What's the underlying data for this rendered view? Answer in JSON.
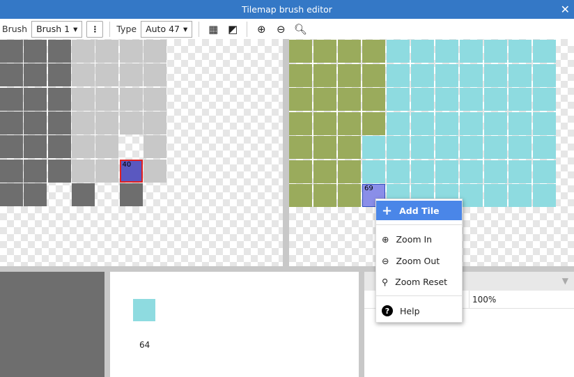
{
  "window": {
    "title": "Tilemap brush editor",
    "close_icon": "close-icon"
  },
  "toolbar": {
    "brush_label": "Brush",
    "brush_value": "Brush 1",
    "type_label": "Type",
    "type_value": "Auto 47",
    "more_icon": "vertical-dots-icon",
    "grid_icon": "grid-icon",
    "mode_icon": "half-square-icon",
    "zoom_in_icon": "zoom-in-icon",
    "zoom_out_icon": "zoom-out-icon",
    "zoom_reset_icon": "search-icon"
  },
  "left_canvas": {
    "selected_tile_label": "40"
  },
  "right_canvas": {
    "hovered_tile_label": "69"
  },
  "context_menu": {
    "items": [
      {
        "label": "Add Tile",
        "icon": "plus-icon"
      },
      {
        "label": "Zoom In",
        "icon": "zoom-in-icon"
      },
      {
        "label": "Zoom Out",
        "icon": "zoom-out-icon"
      },
      {
        "label": "Zoom Reset",
        "icon": "search-icon"
      },
      {
        "label": "Help",
        "icon": "help-icon"
      }
    ]
  },
  "preview": {
    "tile_id": "64",
    "swatch_color": "#8edbe0"
  },
  "properties": {
    "zoom_value": "100%"
  },
  "colors": {
    "accent": "#3478c6",
    "menu_highlight": "#4a86e8",
    "grass": "#9aab5c",
    "water": "#8edbe0"
  }
}
